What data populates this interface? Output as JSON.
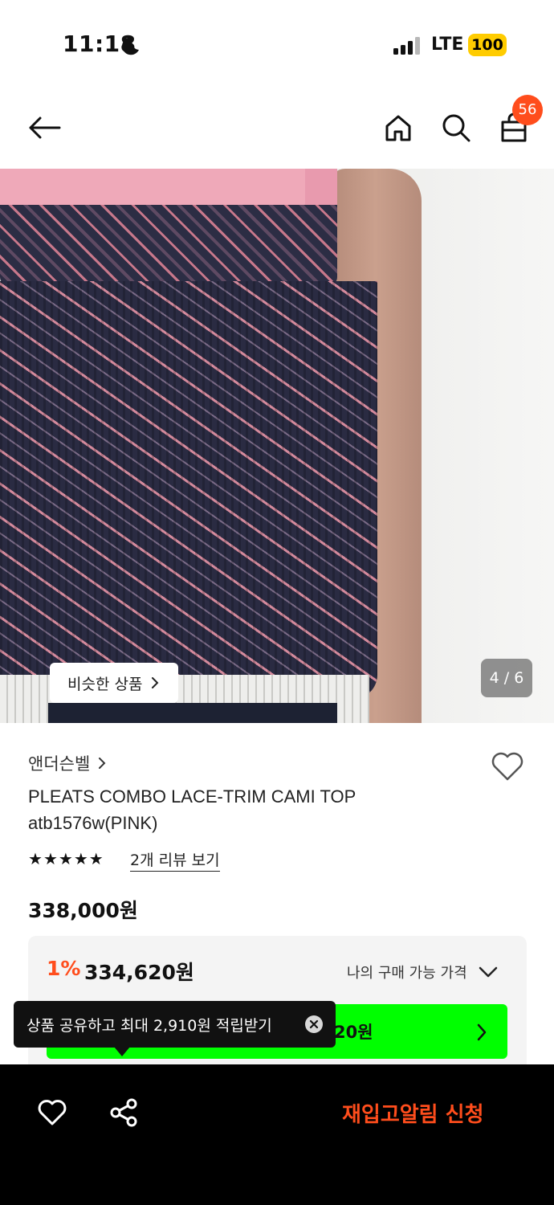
{
  "status_bar": {
    "time": "11:18",
    "network": "LTE",
    "battery": "100"
  },
  "header": {
    "cart_count": "56"
  },
  "gallery": {
    "similar_label": "비슷한 상품",
    "counter": "4 / 6"
  },
  "product": {
    "brand": "앤더슨벨",
    "title": "PLEATS COMBO LACE-TRIM CAMI TOP atb1576w(PINK)",
    "rating": 5,
    "review_link": "2개 리뷰 보기",
    "price": "338,000원",
    "discount_percent": "1%",
    "sale_price": "334,620원",
    "my_price_label": "나의 구매 가능 가격",
    "coupon_button_text": "20원"
  },
  "toast": {
    "message": "상품 공유하고 최대 2,910원 적립받기"
  },
  "bottom_bar": {
    "restock_label": "재입고알림 신청"
  },
  "colors": {
    "accent": "#ff4d1c",
    "coupon_green": "#00ff00"
  }
}
